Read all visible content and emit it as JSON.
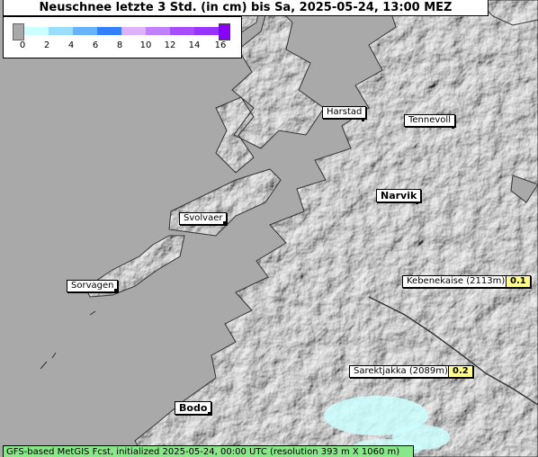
{
  "title": "Neuschnee letzte 3 Std. (in cm) bis Sa, 2025-05-24, 13:00 MEZ",
  "legend": {
    "ticks": [
      "0",
      "2",
      "4",
      "6",
      "8",
      "10",
      "12",
      "14",
      "16"
    ],
    "colors": [
      "#ccffff",
      "#99ddff",
      "#66b3ff",
      "#3380ff",
      "#1a4dff",
      "#ddb3ff",
      "#c080ff",
      "#a64dff",
      "#9933ff"
    ],
    "under_color": "#a9a9a9",
    "over_color": "#8800ff"
  },
  "places": [
    {
      "name": "Harstad",
      "bold": false
    },
    {
      "name": "Tennevoll",
      "bold": false
    },
    {
      "name": "Narvik",
      "bold": true
    },
    {
      "name": "Svolvaer",
      "bold": false
    },
    {
      "name": "Sorvagen",
      "bold": false
    },
    {
      "name": "Kebenekaise (2113m)",
      "bold": false,
      "value": "0.1"
    },
    {
      "name": "Sarektjakka (2089m)",
      "bold": false,
      "value": "0.2"
    },
    {
      "name": "Bodo",
      "bold": true
    }
  ],
  "footer": "GFS-based MetGIS Fcst, initialized 2025-05-24, 00:00 UTC  (resolution 393 m X 1060 m)"
}
